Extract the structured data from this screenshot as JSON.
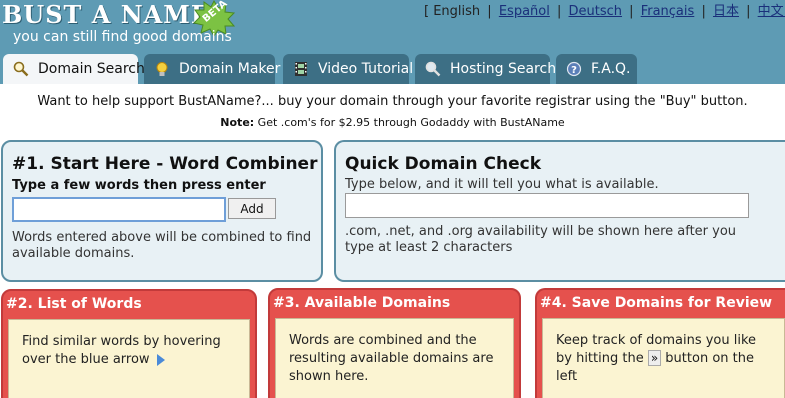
{
  "header": {
    "logo_title": "BUST A NAME",
    "beta_label": "BETA",
    "tagline": "you can still find good domains"
  },
  "languages": [
    "[ English",
    "Español",
    "Deutsch",
    "Français",
    "日本",
    "中文（简体）]"
  ],
  "tabs": [
    {
      "label": "Domain Search",
      "icon": "magnifier-icon",
      "active": true
    },
    {
      "label": "Domain Maker",
      "icon": "lightbulb-icon",
      "active": false
    },
    {
      "label": "Video Tutorial",
      "icon": "film-icon",
      "active": false
    },
    {
      "label": "Hosting Search",
      "icon": "magnifier-icon",
      "active": false
    },
    {
      "label": "F.A.Q.",
      "icon": "help-icon",
      "active": false
    }
  ],
  "support_text": "Want to help support BustAName?... buy your domain through your favorite registrar using the \"Buy\" button.",
  "note": {
    "label": "Note:",
    "text": " Get .com's for $2.95 through Godaddy with BustAName"
  },
  "word_combiner": {
    "title": "#1. Start Here - Word Combiner",
    "subtitle": "Type a few words then press enter",
    "input_value": "",
    "add_label": "Add",
    "description": "Words entered above will be combined to find available domains."
  },
  "quick_check": {
    "title": "Quick Domain Check",
    "subtitle": "Type below, and it will tell you what is available.",
    "input_value": "",
    "description": ".com, .net, and .org availability will be shown here after you type at least 2 characters"
  },
  "list_of_words": {
    "title": "#2. List of Words",
    "description": "Find similar words by hovering over the blue arrow"
  },
  "available_domains": {
    "title": "#3. Available Domains",
    "description": "Words are combined and the resulting available domains are shown here."
  },
  "save_domains": {
    "title": "#4. Save Domains for Review",
    "desc_before": "Keep track of domains you like by hitting the ",
    "button_glyph": "»",
    "desc_after": " button on the left"
  },
  "colors": {
    "header_bg": "#5e9bb4",
    "tab_bg": "#3d6f85",
    "panel_blue": "#e8f1f5",
    "panel_red": "#e5514d",
    "panel_cream": "#fbf4d2",
    "beta_green": "#7cc243"
  }
}
